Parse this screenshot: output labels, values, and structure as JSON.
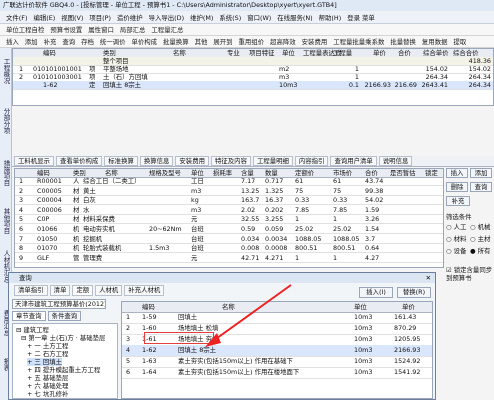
{
  "window": {
    "title": "广联达计价软件 GBQ4.0 - [投标管理 - 单位工程 - 预算书1 - C:\\Users\\Administrator\\Desktop\\xyert\\xyert.GTB4]"
  },
  "menu": [
    "文件(F)",
    "编辑(E)",
    "视图(V)",
    "项目(P)",
    "造价维护",
    "导入导出(D)",
    "维护(M)",
    "系统(S)",
    "窗口(W)",
    "在线服务(N)",
    "帮助(H)",
    "登录 菜单"
  ],
  "toolbar1": [
    "单位工程自检",
    "预算书设置",
    "属性窗口",
    "局部汇总",
    "工程量汇总"
  ],
  "toolbar2": [
    "插入",
    "添加",
    "补充",
    "查询",
    "存档",
    "统一调价",
    "单价构成",
    "批量换算",
    "其他",
    "展开到",
    "重用组价",
    "超高降效",
    "安装费用",
    "工程量批量乘系数",
    "批量替换",
    "复用数据",
    "提取"
  ],
  "left_tabs": [
    "工程概况",
    "分部分项",
    "措施项目",
    "其他项目",
    "人材机汇总",
    "费用汇总",
    "报表"
  ],
  "top_table": {
    "columns": [
      "编码",
      "类别",
      "名称",
      "专业",
      "项目特征",
      "单位",
      "工程量表达式",
      "工程量",
      "单价",
      "合价",
      "综合单价",
      "综合合价"
    ],
    "rows": [
      {
        "code": "",
        "type": "",
        "name": "整个项目",
        "unit": "",
        "qty": "",
        "price": "",
        "total": "",
        "comp_price": "",
        "comp_total": "418.36"
      },
      {
        "num": "1",
        "code": "010101001001",
        "type": "项",
        "name": "平整场地",
        "unit": "m2",
        "qty": "1",
        "price": "",
        "total": "",
        "comp_price": "154.02",
        "comp_total": "154.02"
      },
      {
        "num": "2",
        "code": "010101003001",
        "type": "项",
        "name": "土（石）方回填",
        "unit": "m3",
        "qty": "1",
        "price": "",
        "total": "",
        "comp_price": "264.34",
        "comp_total": "264.34"
      },
      {
        "num": "",
        "code": "1-62",
        "type": "定",
        "name": "回填土 8宗土",
        "unit": "10m3",
        "qty": "0.1",
        "price": "2166.93",
        "total": "216.69",
        "comp_price": "2643.41",
        "comp_total": "264.34"
      }
    ]
  },
  "bottom_tabs": [
    "工料机显示",
    "查看单价构成",
    "标准换算",
    "换算信息",
    "安装费用",
    "特征及内容",
    "工程量明细",
    "内容指引",
    "查询用户清单",
    "说明信息"
  ],
  "bottom_table": {
    "columns": [
      "编码",
      "类别",
      "名称",
      "规格及型号",
      "单位",
      "损耗率",
      "含量",
      "数量",
      "定额价",
      "市场价",
      "合价",
      "是否暂估",
      "锁定"
    ],
    "rows": [
      [
        "R00001",
        "人",
        "综合工日（二类工）",
        "",
        "工日",
        "",
        "7.17",
        "0.717",
        "61",
        "61",
        "43.74"
      ],
      [
        "C00005",
        "材",
        "黄土",
        "",
        "m3",
        "",
        "13.25",
        "1.325",
        "75",
        "75",
        "99.38"
      ],
      [
        "C00004",
        "材",
        "白灰",
        "",
        "kg",
        "",
        "163.7",
        "16.37",
        "0.33",
        "0.33",
        "54.02"
      ],
      [
        "C00006",
        "材",
        "水",
        "",
        "m3",
        "",
        "2.02",
        "0.202",
        "7.85",
        "7.85",
        "1.59"
      ],
      [
        "C0P",
        "材",
        "材料采保费",
        "",
        "元",
        "",
        "32.55",
        "3.255",
        "1",
        "1",
        "3.26"
      ],
      [
        "01066",
        "机",
        "电动夯实机",
        "20~62Nm",
        "台班",
        "",
        "0.59",
        "0.059",
        "25.02",
        "25.02",
        "1.54"
      ],
      [
        "01050",
        "机",
        "挖掘机",
        "",
        "台班",
        "",
        "0.034",
        "0.0034",
        "1088.05",
        "1088.05",
        "3.7"
      ],
      [
        "01070",
        "机",
        "轮胎式装载机",
        "1.5m3",
        "台班",
        "",
        "0.008",
        "0.0008",
        "800.51",
        "800.51",
        "0.64"
      ],
      [
        "GLF",
        "管",
        "管理费",
        "",
        "元",
        "",
        "42.71",
        "4.271",
        "1",
        "1",
        "4.27"
      ]
    ]
  },
  "side_buttons": [
    "插入",
    "添加",
    "删除",
    "查询",
    "补充"
  ],
  "filter": {
    "label": "筛选条件",
    "options": [
      "人工",
      "机械",
      "材料",
      "主材",
      "设备",
      "所有"
    ],
    "checkbox": "锁定含量同步到预算书"
  },
  "dialog": {
    "title": "查询",
    "tabs": [
      "清单指引",
      "清单",
      "定额",
      "人材机",
      "补充人材机"
    ],
    "lib_select": "天津市建筑工程预算基价(2012)",
    "subtabs": [
      "章节查询",
      "条件查询"
    ],
    "insert_btn": "插入(I)",
    "replace_btn": "替换(R)",
    "columns": [
      "编码",
      "名称",
      "单位",
      "单价"
    ],
    "rows": [
      [
        "1",
        "1-59",
        "回填土",
        "10m3",
        "161.43"
      ],
      [
        "2",
        "1-60",
        "场地填土 松填",
        "10m3",
        "870.29"
      ],
      [
        "3",
        "1-61",
        "场地填土 夯填",
        "10m3",
        "1205.95"
      ],
      [
        "4",
        "1-62",
        "回填土 8宗土",
        "10m3",
        "2166.93"
      ],
      [
        "5",
        "1-63",
        "素土夯实(包括150m以上) 作用在基础下",
        "10m3",
        "1524.92"
      ],
      [
        "6",
        "1-64",
        "素土夯实(包括150m以上) 作用在楼地面下",
        "10m3",
        "1541.92"
      ]
    ],
    "tree": [
      "建筑工程",
      "第一章 土(石)方 · 基础垫层",
      "一 土方工程",
      "二 石方工程",
      "三 回填土",
      "四 提升模起重土方工程",
      "五 基础垫层",
      "六 基础处理",
      "七 坑孔修补",
      "第二章 桩与地基基础工程",
      "第三章 混凝土工程"
    ]
  }
}
